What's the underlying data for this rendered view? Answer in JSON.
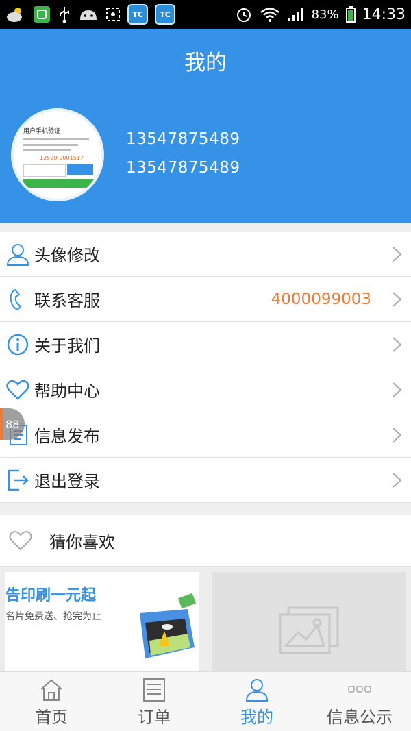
{
  "status_bar": {
    "notif_badges": [
      "TC",
      "TC"
    ],
    "battery": "83%",
    "time": "14:33"
  },
  "header": {
    "title": "我的",
    "phone_line1": "13547875489",
    "phone_line2": "13547875489",
    "avatar_text": {
      "title": "用户手机验证",
      "code": "12590-9001517"
    }
  },
  "menu": {
    "items": [
      {
        "label": "头像修改",
        "icon": "user-icon"
      },
      {
        "label": "联系客服",
        "icon": "phone-icon",
        "value": "4000099003"
      },
      {
        "label": "关于我们",
        "icon": "info-icon"
      },
      {
        "label": "帮助中心",
        "icon": "heart-icon"
      },
      {
        "label": "信息发布",
        "icon": "document-icon"
      },
      {
        "label": "退出登录",
        "icon": "logout-icon"
      }
    ]
  },
  "guess": {
    "label": "猜你喜欢"
  },
  "cards": {
    "card1_title": "告印刷一元起",
    "card1_sub": "名片免费送、抢完为止"
  },
  "float_tab": {
    "label": "88"
  },
  "bottom_nav": {
    "items": [
      {
        "label": "首页",
        "icon": "home-icon"
      },
      {
        "label": "订单",
        "icon": "list-icon"
      },
      {
        "label": "我的",
        "icon": "profile-icon",
        "active": true
      },
      {
        "label": "信息公示",
        "icon": "more-icon"
      }
    ]
  },
  "colors": {
    "primary": "#3592e6",
    "accent": "#f07a33"
  }
}
